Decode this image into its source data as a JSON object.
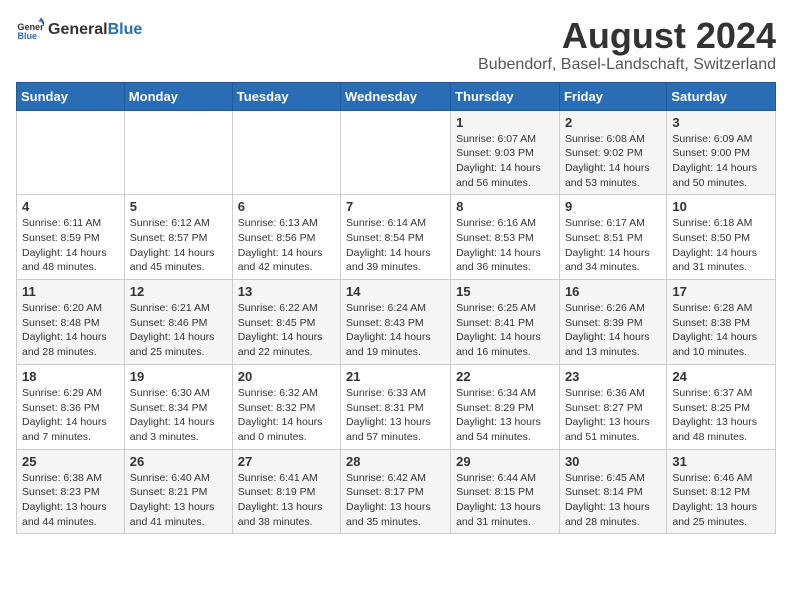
{
  "logo": {
    "general": "General",
    "blue": "Blue"
  },
  "title": "August 2024",
  "subtitle": "Bubendorf, Basel-Landschaft, Switzerland",
  "weekdays": [
    "Sunday",
    "Monday",
    "Tuesday",
    "Wednesday",
    "Thursday",
    "Friday",
    "Saturday"
  ],
  "weeks": [
    [
      {
        "day": "",
        "info": ""
      },
      {
        "day": "",
        "info": ""
      },
      {
        "day": "",
        "info": ""
      },
      {
        "day": "",
        "info": ""
      },
      {
        "day": "1",
        "info": "Sunrise: 6:07 AM\nSunset: 9:03 PM\nDaylight: 14 hours\nand 56 minutes."
      },
      {
        "day": "2",
        "info": "Sunrise: 6:08 AM\nSunset: 9:02 PM\nDaylight: 14 hours\nand 53 minutes."
      },
      {
        "day": "3",
        "info": "Sunrise: 6:09 AM\nSunset: 9:00 PM\nDaylight: 14 hours\nand 50 minutes."
      }
    ],
    [
      {
        "day": "4",
        "info": "Sunrise: 6:11 AM\nSunset: 8:59 PM\nDaylight: 14 hours\nand 48 minutes."
      },
      {
        "day": "5",
        "info": "Sunrise: 6:12 AM\nSunset: 8:57 PM\nDaylight: 14 hours\nand 45 minutes."
      },
      {
        "day": "6",
        "info": "Sunrise: 6:13 AM\nSunset: 8:56 PM\nDaylight: 14 hours\nand 42 minutes."
      },
      {
        "day": "7",
        "info": "Sunrise: 6:14 AM\nSunset: 8:54 PM\nDaylight: 14 hours\nand 39 minutes."
      },
      {
        "day": "8",
        "info": "Sunrise: 6:16 AM\nSunset: 8:53 PM\nDaylight: 14 hours\nand 36 minutes."
      },
      {
        "day": "9",
        "info": "Sunrise: 6:17 AM\nSunset: 8:51 PM\nDaylight: 14 hours\nand 34 minutes."
      },
      {
        "day": "10",
        "info": "Sunrise: 6:18 AM\nSunset: 8:50 PM\nDaylight: 14 hours\nand 31 minutes."
      }
    ],
    [
      {
        "day": "11",
        "info": "Sunrise: 6:20 AM\nSunset: 8:48 PM\nDaylight: 14 hours\nand 28 minutes."
      },
      {
        "day": "12",
        "info": "Sunrise: 6:21 AM\nSunset: 8:46 PM\nDaylight: 14 hours\nand 25 minutes."
      },
      {
        "day": "13",
        "info": "Sunrise: 6:22 AM\nSunset: 8:45 PM\nDaylight: 14 hours\nand 22 minutes."
      },
      {
        "day": "14",
        "info": "Sunrise: 6:24 AM\nSunset: 8:43 PM\nDaylight: 14 hours\nand 19 minutes."
      },
      {
        "day": "15",
        "info": "Sunrise: 6:25 AM\nSunset: 8:41 PM\nDaylight: 14 hours\nand 16 minutes."
      },
      {
        "day": "16",
        "info": "Sunrise: 6:26 AM\nSunset: 8:39 PM\nDaylight: 14 hours\nand 13 minutes."
      },
      {
        "day": "17",
        "info": "Sunrise: 6:28 AM\nSunset: 8:38 PM\nDaylight: 14 hours\nand 10 minutes."
      }
    ],
    [
      {
        "day": "18",
        "info": "Sunrise: 6:29 AM\nSunset: 8:36 PM\nDaylight: 14 hours\nand 7 minutes."
      },
      {
        "day": "19",
        "info": "Sunrise: 6:30 AM\nSunset: 8:34 PM\nDaylight: 14 hours\nand 3 minutes."
      },
      {
        "day": "20",
        "info": "Sunrise: 6:32 AM\nSunset: 8:32 PM\nDaylight: 14 hours\nand 0 minutes."
      },
      {
        "day": "21",
        "info": "Sunrise: 6:33 AM\nSunset: 8:31 PM\nDaylight: 13 hours\nand 57 minutes."
      },
      {
        "day": "22",
        "info": "Sunrise: 6:34 AM\nSunset: 8:29 PM\nDaylight: 13 hours\nand 54 minutes."
      },
      {
        "day": "23",
        "info": "Sunrise: 6:36 AM\nSunset: 8:27 PM\nDaylight: 13 hours\nand 51 minutes."
      },
      {
        "day": "24",
        "info": "Sunrise: 6:37 AM\nSunset: 8:25 PM\nDaylight: 13 hours\nand 48 minutes."
      }
    ],
    [
      {
        "day": "25",
        "info": "Sunrise: 6:38 AM\nSunset: 8:23 PM\nDaylight: 13 hours\nand 44 minutes."
      },
      {
        "day": "26",
        "info": "Sunrise: 6:40 AM\nSunset: 8:21 PM\nDaylight: 13 hours\nand 41 minutes."
      },
      {
        "day": "27",
        "info": "Sunrise: 6:41 AM\nSunset: 8:19 PM\nDaylight: 13 hours\nand 38 minutes."
      },
      {
        "day": "28",
        "info": "Sunrise: 6:42 AM\nSunset: 8:17 PM\nDaylight: 13 hours\nand 35 minutes."
      },
      {
        "day": "29",
        "info": "Sunrise: 6:44 AM\nSunset: 8:15 PM\nDaylight: 13 hours\nand 31 minutes."
      },
      {
        "day": "30",
        "info": "Sunrise: 6:45 AM\nSunset: 8:14 PM\nDaylight: 13 hours\nand 28 minutes."
      },
      {
        "day": "31",
        "info": "Sunrise: 6:46 AM\nSunset: 8:12 PM\nDaylight: 13 hours\nand 25 minutes."
      }
    ]
  ]
}
